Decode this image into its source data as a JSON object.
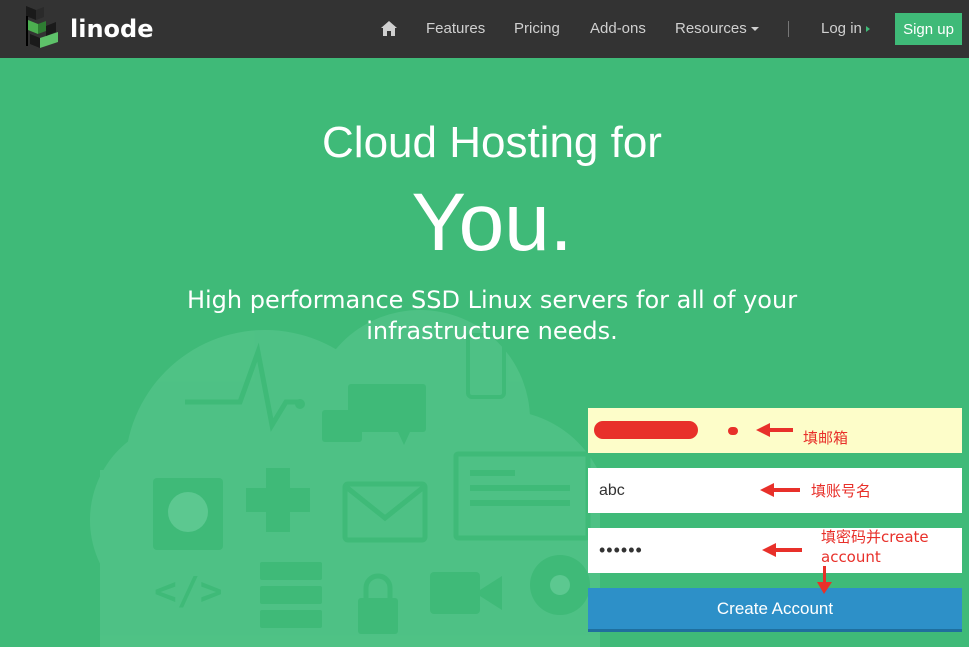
{
  "brand": {
    "name": "linode"
  },
  "nav": {
    "home_icon": "home-icon",
    "items": [
      "Features",
      "Pricing",
      "Add-ons",
      "Resources"
    ],
    "login": "Log in",
    "signup": "Sign up"
  },
  "hero": {
    "title": "Cloud Hosting for",
    "emphasis": "You.",
    "subtitle": "High performance SSD Linux servers for all of your infrastructure needs."
  },
  "form": {
    "email_value": "",
    "username_value": "abc",
    "password_value": "••••••",
    "submit": "Create Account"
  },
  "annotations": {
    "email": "填邮箱",
    "username": "填账号名",
    "password": "填密码并create account"
  },
  "colors": {
    "hero_bg": "#3fba78",
    "navbar_bg": "#333333",
    "submit_bg": "#2d90c8",
    "annotation": "#e8302a",
    "email_field_bg": "#fdfdc9"
  }
}
